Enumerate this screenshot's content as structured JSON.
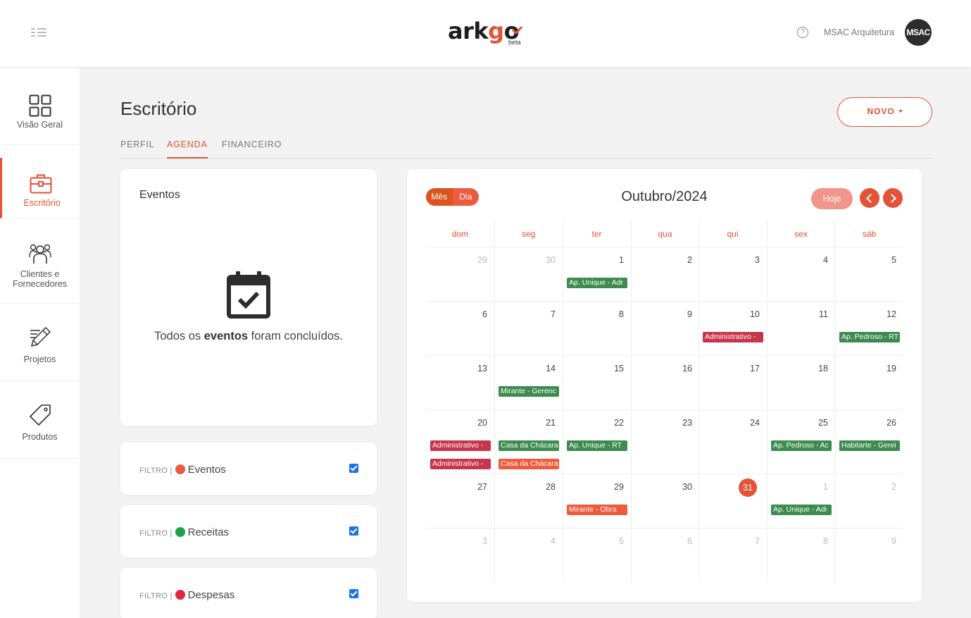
{
  "header": {
    "logo_text": "arkgo",
    "logo_badge": "beta",
    "help_icon": "question-circle-icon",
    "user_name": "MSAC Arquitetura",
    "avatar_text": "MSAC"
  },
  "sidebar": {
    "items": [
      {
        "label": "Visão Geral",
        "icon": "grid-icon",
        "active": false
      },
      {
        "label": "Escritório",
        "icon": "briefcase-icon",
        "active": true
      },
      {
        "label": "Clientes e Fornecedores",
        "icon": "people-icon",
        "active": false
      },
      {
        "label": "Projetos",
        "icon": "ruler-pencil-icon",
        "active": false
      },
      {
        "label": "Produtos",
        "icon": "tag-icon",
        "active": false
      }
    ]
  },
  "page": {
    "title": "Escritório",
    "new_button": "NOVO",
    "tabs": [
      "PERFIL",
      "AGENDA",
      "FINANCEIRO"
    ],
    "active_tab": "AGENDA"
  },
  "events_panel": {
    "title": "Eventos",
    "icon": "calendar-check-icon",
    "msg_prefix": "Todos os ",
    "msg_bold": "eventos",
    "msg_suffix": " foram concluídos."
  },
  "filters": [
    {
      "prefix": "FILTRO |",
      "name": "Eventos",
      "color": "#f05a3c",
      "checked": true
    },
    {
      "prefix": "FILTRO |",
      "name": "Receitas",
      "color": "#21a048",
      "checked": true
    },
    {
      "prefix": "FILTRO |",
      "name": "Despesas",
      "color": "#e0273f",
      "checked": true
    }
  ],
  "calendar": {
    "view_month": "Mês",
    "view_day": "Dia",
    "title": "Outubro/2024",
    "today_button": "Hoje",
    "weekdays": [
      "dom",
      "seg",
      "ter",
      "qua",
      "qui",
      "sex",
      "sáb"
    ],
    "weeks": [
      [
        "29",
        "30",
        "1",
        "2",
        "3",
        "4",
        "5"
      ],
      [
        "6",
        "7",
        "8",
        "9",
        "10",
        "11",
        "12"
      ],
      [
        "13",
        "14",
        "15",
        "16",
        "17",
        "18",
        "19"
      ],
      [
        "20",
        "21",
        "22",
        "23",
        "24",
        "25",
        "26"
      ],
      [
        "27",
        "28",
        "29",
        "30",
        "31",
        "1",
        "2"
      ],
      [
        "3",
        "4",
        "5",
        "6",
        "7",
        "8",
        "9"
      ]
    ],
    "today": "31",
    "colors": {
      "green": "#3d8b4f",
      "red": "#c7354c",
      "orange": "#f05a3c"
    },
    "events": [
      {
        "week": 0,
        "day": 2,
        "slot": 0,
        "label": "Ap. Unique - Adr",
        "color": "green"
      },
      {
        "week": 1,
        "day": 4,
        "slot": 0,
        "label": "Administrativo -",
        "color": "red"
      },
      {
        "week": 1,
        "day": 6,
        "slot": 0,
        "label": "Ap. Pedroso - RT",
        "color": "green"
      },
      {
        "week": 2,
        "day": 1,
        "slot": 0,
        "label": "Mirante - Gerenc",
        "color": "green"
      },
      {
        "week": 3,
        "day": 0,
        "slot": 0,
        "label": "Administrativo -",
        "color": "red"
      },
      {
        "week": 3,
        "day": 0,
        "slot": 1,
        "label": "Administrativo -",
        "color": "red"
      },
      {
        "week": 3,
        "day": 1,
        "slot": 0,
        "label": "Casa da Chácara",
        "color": "green"
      },
      {
        "week": 3,
        "day": 1,
        "slot": 1,
        "label": "Casa da Chácara",
        "color": "orange"
      },
      {
        "week": 3,
        "day": 2,
        "slot": 0,
        "label": "Ap. Unique - RT",
        "color": "green"
      },
      {
        "week": 3,
        "day": 5,
        "slot": 0,
        "label": "Ap. Pedroso - Ac",
        "color": "green"
      },
      {
        "week": 3,
        "day": 6,
        "slot": 0,
        "label": "Habitarte - Gerei",
        "color": "green"
      },
      {
        "week": 4,
        "day": 2,
        "slot": 0,
        "label": "Mirante - Obra",
        "color": "orange"
      },
      {
        "week": 4,
        "day": 5,
        "slot": 0,
        "label": "Ap. Unique - Adr",
        "color": "green"
      }
    ]
  }
}
